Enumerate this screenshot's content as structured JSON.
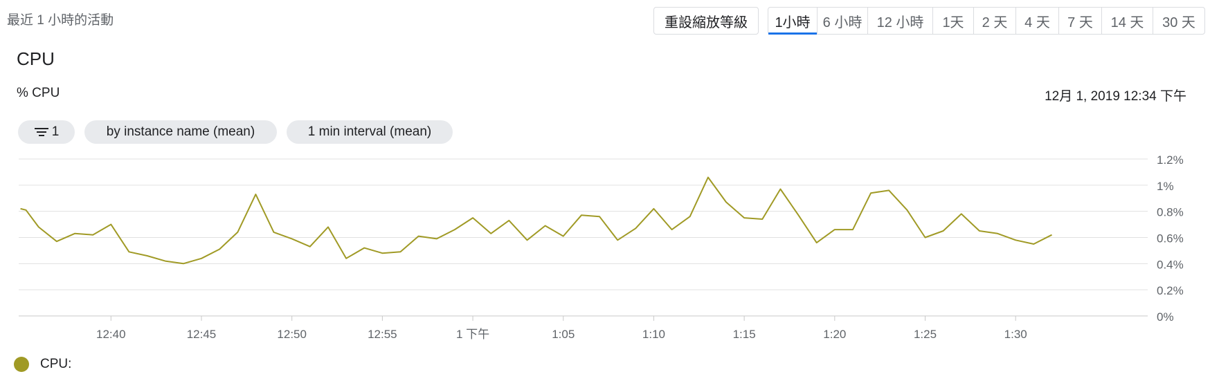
{
  "header": {
    "activity_label": "最近 1 小時的活動",
    "reset_zoom_label": "重設縮放等級"
  },
  "time_ranges": [
    {
      "label": "1小時",
      "active": true
    },
    {
      "label": "6 小時",
      "active": false
    },
    {
      "label": "12 小時",
      "active": false
    },
    {
      "label": "1天",
      "active": false
    },
    {
      "label": "2 天",
      "active": false
    },
    {
      "label": "4 天",
      "active": false
    },
    {
      "label": "7 天",
      "active": false
    },
    {
      "label": "14 天",
      "active": false
    },
    {
      "label": "30 天",
      "active": false
    }
  ],
  "chart_panel": {
    "title": "CPU",
    "metric_label": "% CPU",
    "timestamp": "12月 1, 2019 12:34 下午",
    "chips": {
      "filter_count": "1",
      "group_by": "by instance name (mean)",
      "interval": "1 min interval (mean)"
    },
    "legend": {
      "label": "CPU:",
      "color": "#a09a25"
    }
  },
  "icons": {
    "filter": "filter-icon",
    "legend_marker": "legend-dot-icon"
  },
  "colors": {
    "series": "#a09a25",
    "active_tab_underline": "#1a73e8",
    "chip_bg": "#e8eaed",
    "grid": "#e0e0e0"
  },
  "chart_data": {
    "type": "line",
    "xlabel": "",
    "ylabel": "",
    "ylim": [
      0,
      1.2
    ],
    "yticks": [
      {
        "value": 0,
        "label": "0%"
      },
      {
        "value": 0.2,
        "label": "0.2%"
      },
      {
        "value": 0.4,
        "label": "0.4%"
      },
      {
        "value": 0.6,
        "label": "0.6%"
      },
      {
        "value": 0.8,
        "label": "0.8%"
      },
      {
        "value": 1.0,
        "label": "1%"
      },
      {
        "value": 1.2,
        "label": "1.2%"
      }
    ],
    "xticks": [
      "12:40",
      "12:45",
      "12:50",
      "12:55",
      "1 下午",
      "1:05",
      "1:10",
      "1:15",
      "1:20",
      "1:25",
      "1:30"
    ],
    "x_minute_range": [
      34.9,
      97.3
    ],
    "xtick_minutes": [
      40,
      45,
      50,
      55,
      60,
      65,
      70,
      75,
      80,
      85,
      90
    ],
    "grid": true,
    "legend": "bottom-left",
    "series": [
      {
        "name": "CPU",
        "color": "#a09a25",
        "x_minutes": [
          35,
          35.3,
          36,
          37,
          38,
          39,
          40,
          41,
          42,
          43,
          44,
          45,
          46,
          47,
          48,
          49,
          50,
          51,
          52,
          53,
          54,
          55,
          56,
          57,
          58,
          59,
          60,
          61,
          62,
          63,
          64,
          65,
          66,
          67,
          68,
          69,
          70,
          71,
          72,
          73,
          74,
          75,
          76,
          77,
          78,
          79,
          80,
          81,
          82,
          83,
          84,
          85,
          86,
          87,
          88,
          89,
          90,
          91,
          92
        ],
        "values": [
          0.82,
          0.81,
          0.68,
          0.57,
          0.63,
          0.62,
          0.7,
          0.49,
          0.46,
          0.42,
          0.4,
          0.44,
          0.51,
          0.64,
          0.93,
          0.64,
          0.59,
          0.53,
          0.68,
          0.44,
          0.52,
          0.48,
          0.49,
          0.61,
          0.59,
          0.66,
          0.75,
          0.63,
          0.73,
          0.58,
          0.69,
          0.61,
          0.77,
          0.76,
          0.58,
          0.67,
          0.82,
          0.66,
          0.76,
          1.06,
          0.87,
          0.75,
          0.74,
          0.97,
          0.77,
          0.56,
          0.66,
          0.66,
          0.94,
          0.96,
          0.81,
          0.6,
          0.65,
          0.78,
          0.65,
          0.63,
          0.58,
          0.55,
          0.62
        ]
      }
    ]
  }
}
